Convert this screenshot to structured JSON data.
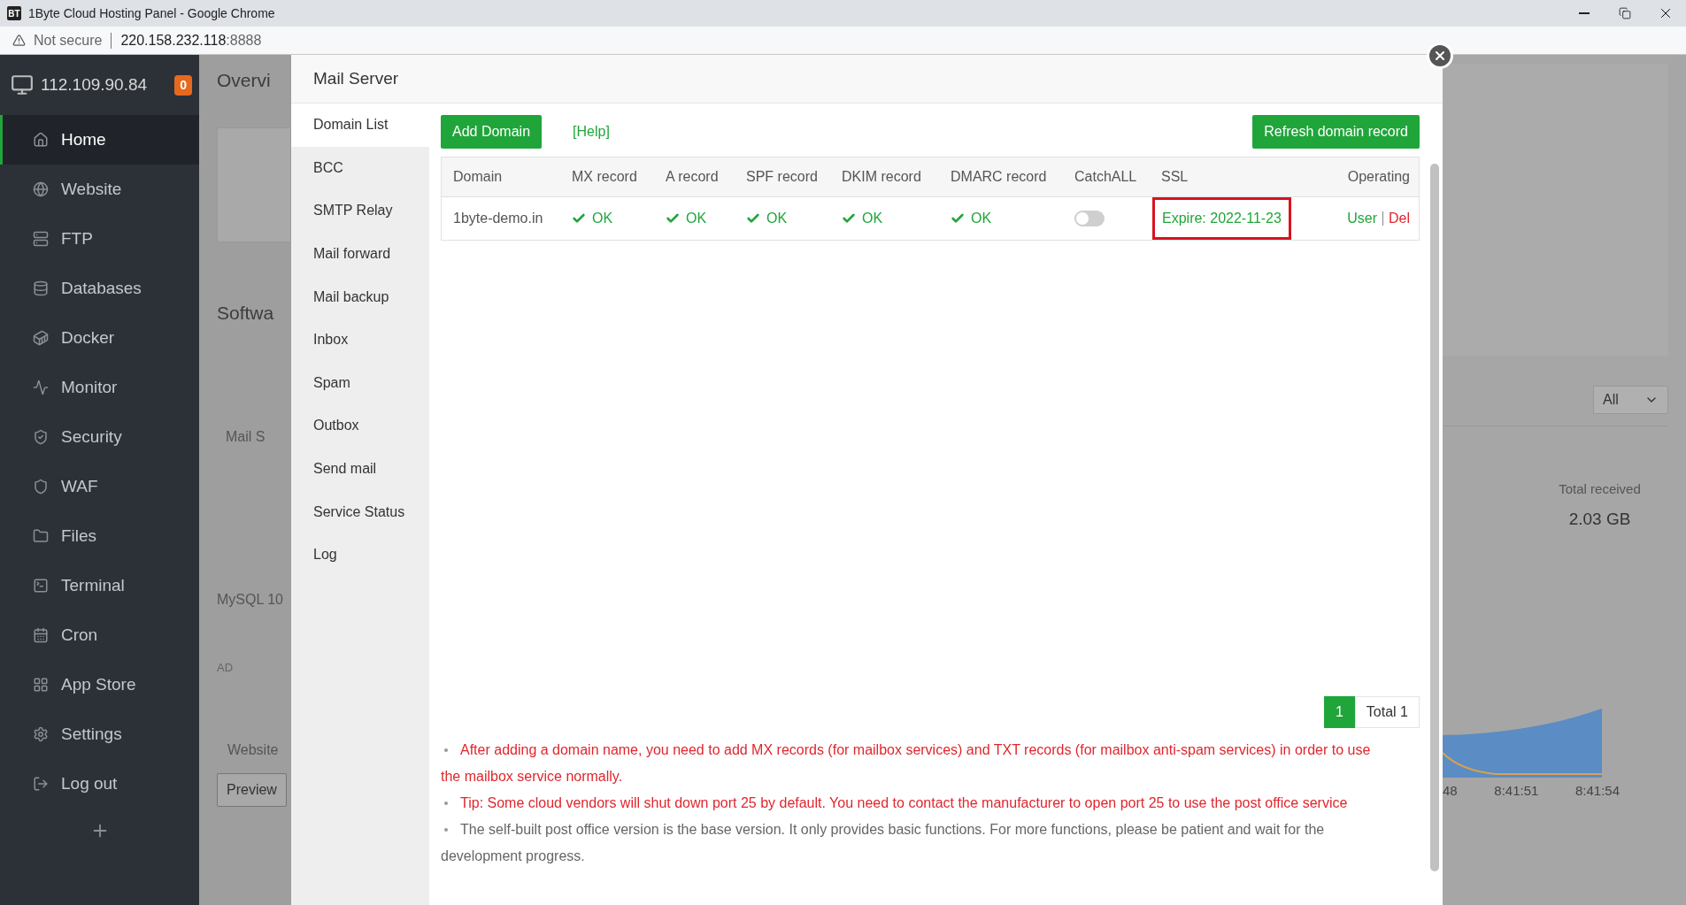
{
  "browser": {
    "logo": "BT",
    "title": "1Byte Cloud Hosting Panel - Google Chrome",
    "security": "Not secure",
    "url_host": "220.158.232.118",
    "url_port": ":8888"
  },
  "sidebar": {
    "ip": "112.109.90.84",
    "badge": "0",
    "items": [
      {
        "label": "Home",
        "selected": true
      },
      {
        "label": "Website",
        "selected": false
      },
      {
        "label": "FTP",
        "selected": false
      },
      {
        "label": "Databases",
        "selected": false
      },
      {
        "label": "Docker",
        "selected": false
      },
      {
        "label": "Monitor",
        "selected": false
      },
      {
        "label": "Security",
        "selected": false
      },
      {
        "label": "WAF",
        "selected": false
      },
      {
        "label": "Files",
        "selected": false
      },
      {
        "label": "Terminal",
        "selected": false
      },
      {
        "label": "Cron",
        "selected": false
      },
      {
        "label": "App Store",
        "selected": false
      },
      {
        "label": "Settings",
        "selected": false
      },
      {
        "label": "Log out",
        "selected": false
      }
    ]
  },
  "background": {
    "overview_title": "Overvi",
    "software_title": "Softwa",
    "app_label": "Mail S",
    "db_label": "MySQL 10",
    "ad_tag": "AD",
    "website_label": "Website",
    "preview_button": "Preview",
    "filter_select": "All",
    "total_label": "Total received",
    "total_value": "2.03 GB",
    "chart_times": [
      "48",
      "8:41:51",
      "8:41:54"
    ]
  },
  "modal": {
    "title": "Mail Server",
    "nav": [
      {
        "label": "Domain List",
        "selected": true
      },
      {
        "label": "BCC",
        "selected": false
      },
      {
        "label": "SMTP Relay",
        "selected": false
      },
      {
        "label": "Mail forward",
        "selected": false
      },
      {
        "label": "Mail backup",
        "selected": false
      },
      {
        "label": "Inbox",
        "selected": false
      },
      {
        "label": "Spam",
        "selected": false
      },
      {
        "label": "Outbox",
        "selected": false
      },
      {
        "label": "Send mail",
        "selected": false
      },
      {
        "label": "Service Status",
        "selected": false
      },
      {
        "label": "Log",
        "selected": false
      }
    ],
    "add_button": "Add Domain",
    "help_link": "[Help]",
    "refresh_button": "Refresh domain record",
    "table": {
      "columns": [
        "Domain",
        "MX record",
        "A record",
        "SPF record",
        "DKIM record",
        "DMARC record",
        "CatchALL",
        "SSL",
        "Operating"
      ],
      "rows": [
        {
          "domain": "1byte-demo.in",
          "records": [
            {
              "kind": "ok",
              "text": "OK"
            },
            {
              "kind": "ok",
              "text": "OK"
            },
            {
              "kind": "ok",
              "text": "OK"
            },
            {
              "kind": "ok",
              "text": "OK"
            },
            {
              "kind": "ok",
              "text": "OK"
            }
          ],
          "catchall_on": false,
          "ssl": {
            "text": "Expire: 2022-11-23",
            "highlighted": true
          },
          "actions": [
            {
              "label": "User",
              "kind": "link"
            },
            {
              "label": "Del",
              "kind": "danger"
            }
          ]
        }
      ]
    },
    "pagination": {
      "pages": [
        {
          "label": "1",
          "selected": true
        }
      ],
      "total": "Total 1"
    },
    "notes": [
      {
        "kind": "warning",
        "text": "After adding a domain name, you need to add MX records (for mailbox services) and TXT records (for mailbox anti-spam services) in order to use the mailbox service normally."
      },
      {
        "kind": "warning",
        "text": "Tip: Some cloud vendors will shut down port 25 by default. You need to contact the manufacturer to open port 25 to use the post office service"
      },
      {
        "kind": "info",
        "text": "The self-built post office version is the base version. It only provides basic functions. For more functions, please be patient and wait for the development progress."
      }
    ]
  }
}
